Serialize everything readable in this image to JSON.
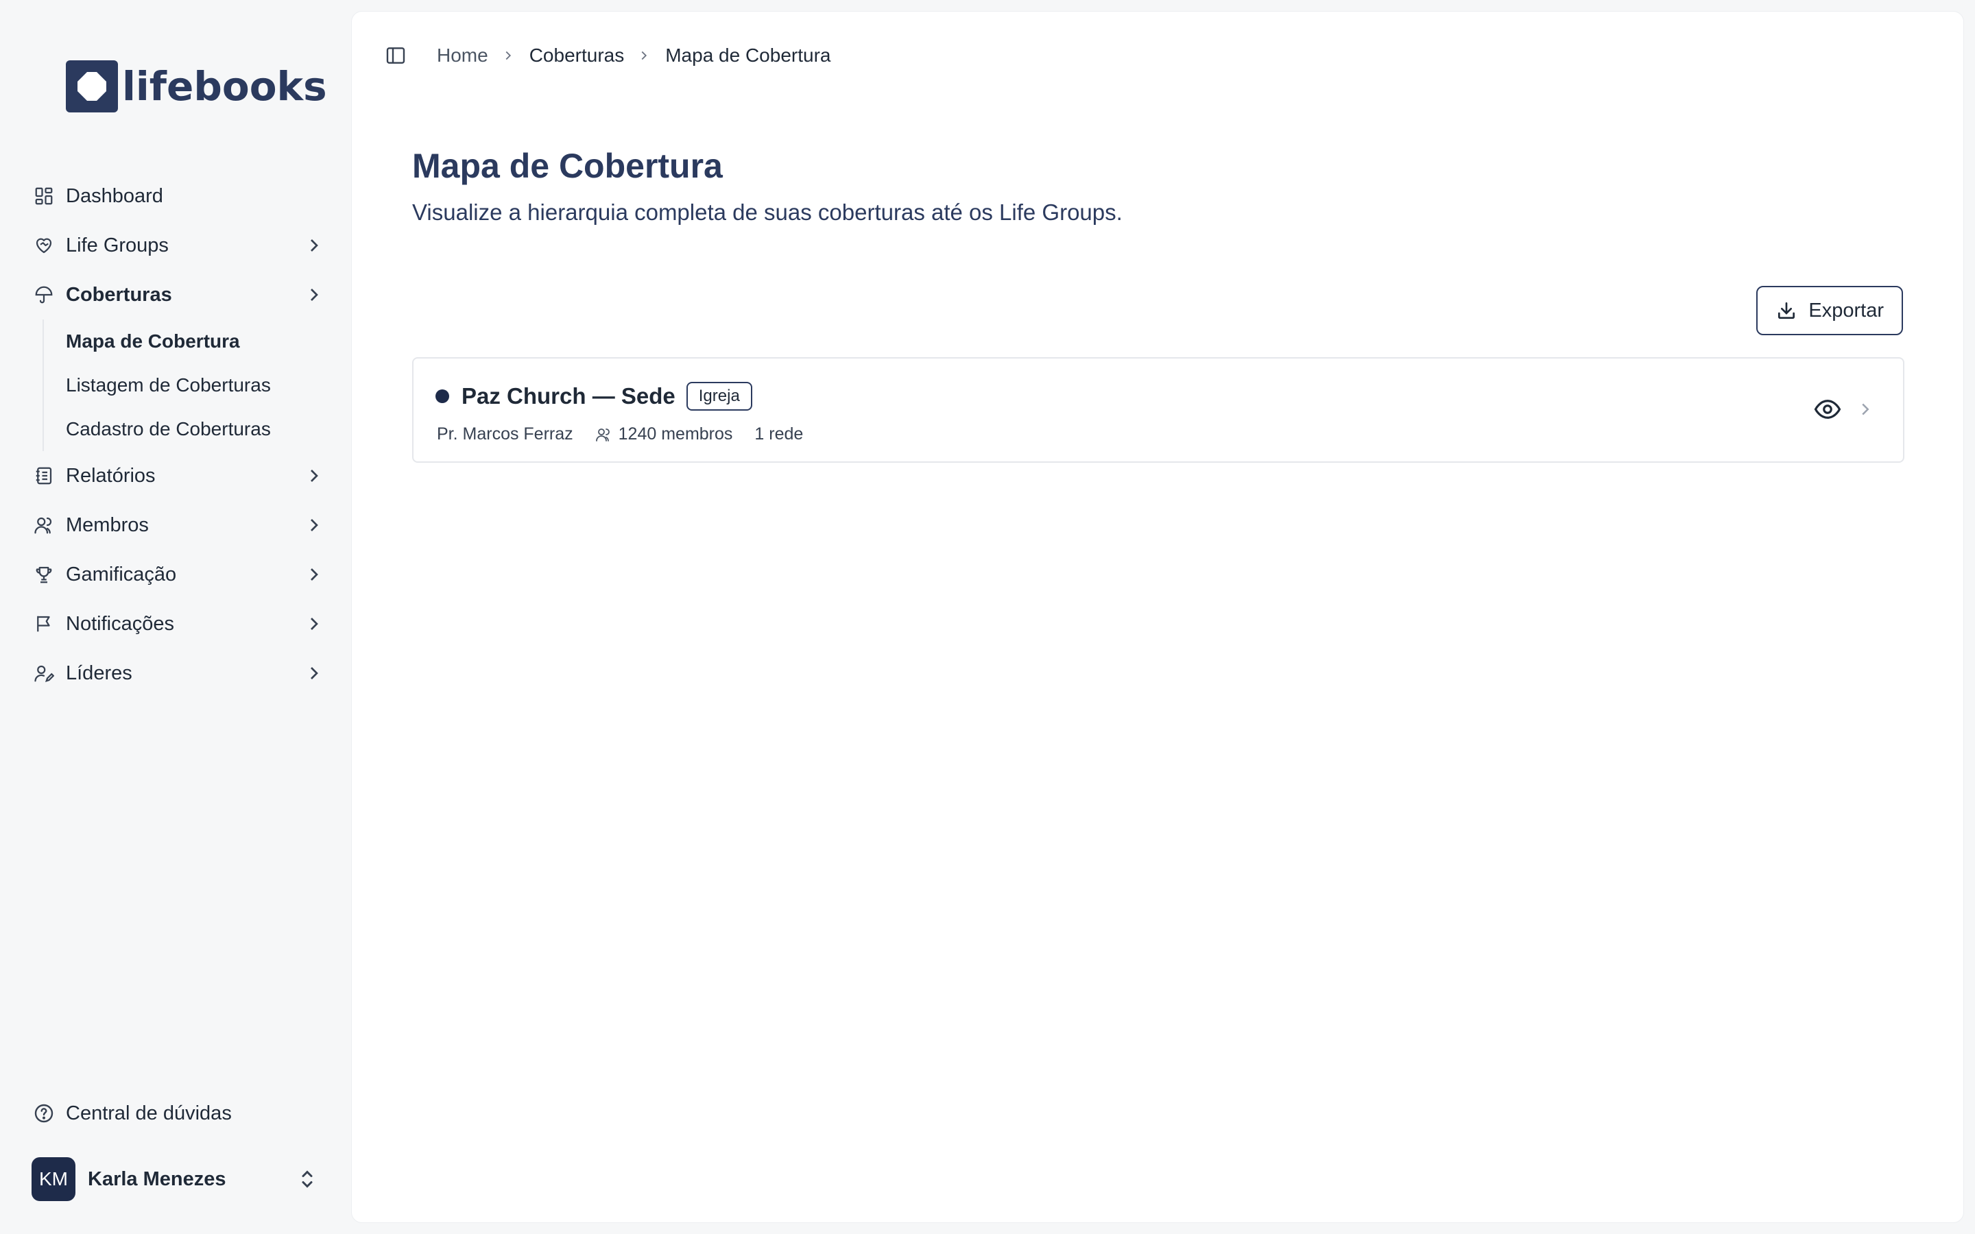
{
  "brand": {
    "name": "lifebooks"
  },
  "sidebar": {
    "items": [
      {
        "label": "Dashboard",
        "icon": "dashboard-icon"
      },
      {
        "label": "Life Groups",
        "icon": "heart-handshake-icon"
      },
      {
        "label": "Coberturas",
        "icon": "umbrella-icon",
        "subitems": [
          {
            "label": "Mapa de Cobertura"
          },
          {
            "label": "Listagem de Coberturas"
          },
          {
            "label": "Cadastro de Coberturas"
          }
        ]
      },
      {
        "label": "Relatórios",
        "icon": "notebook-icon"
      },
      {
        "label": "Membros",
        "icon": "users-icon"
      },
      {
        "label": "Gamificação",
        "icon": "trophy-icon"
      },
      {
        "label": "Notificações",
        "icon": "message-flag-icon"
      },
      {
        "label": "Líderes",
        "icon": "user-pen-icon"
      }
    ],
    "help_label": "Central de dúvidas",
    "user": {
      "initials": "KM",
      "name": "Karla Menezes"
    }
  },
  "breadcrumb": {
    "items": [
      "Home",
      "Coberturas",
      "Mapa de Cobertura"
    ]
  },
  "page": {
    "title": "Mapa de Cobertura",
    "subtitle": "Visualize a hierarquia completa de suas coberturas até os Life Groups.",
    "export_label": "Exportar"
  },
  "coverage_card": {
    "title": "Paz Church — Sede",
    "badge": "Igreja",
    "pastor": "Pr. Marcos Ferraz",
    "members": "1240 membros",
    "networks": "1 rede"
  },
  "colors": {
    "accent": "#2b3a5e",
    "avatar_bg": "#1e2b4a",
    "panel_bg": "#ffffff",
    "app_bg": "#f6f7f8"
  }
}
